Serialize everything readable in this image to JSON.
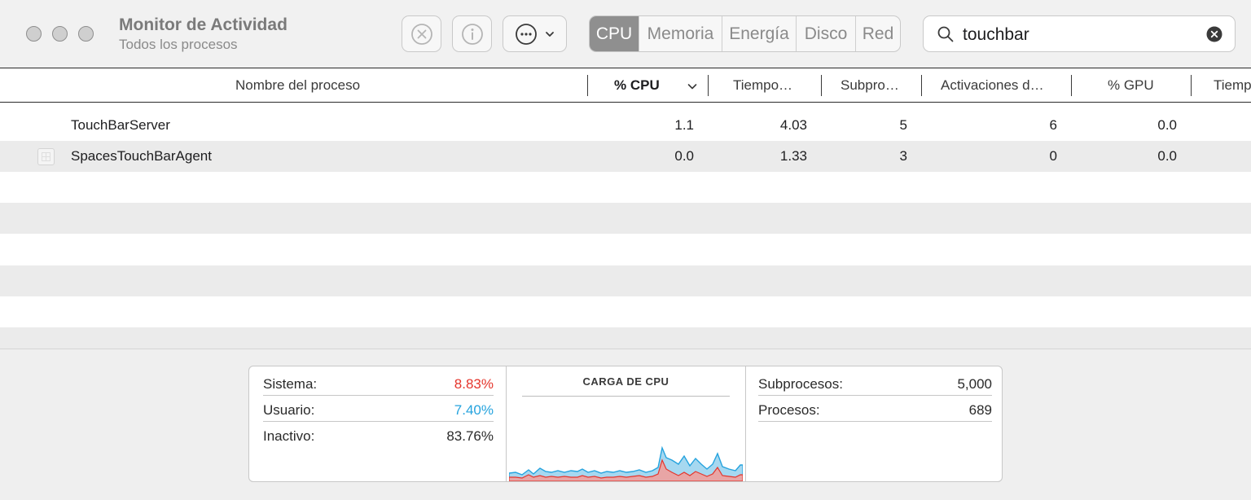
{
  "window": {
    "title": "Monitor de Actividad",
    "subtitle": "Todos los procesos"
  },
  "toolbar": {
    "stop_icon": "stop-process-icon",
    "info_icon": "info-icon",
    "more_icon": "ellipsis-icon",
    "tabs": [
      {
        "label": "CPU",
        "active": true
      },
      {
        "label": "Memoria",
        "active": false
      },
      {
        "label": "Energía",
        "active": false
      },
      {
        "label": "Disco",
        "active": false
      },
      {
        "label": "Red",
        "active": false
      }
    ]
  },
  "search": {
    "value": "touchbar"
  },
  "table": {
    "columns": [
      "Nombre del proceso",
      "% CPU",
      "Tiempo…",
      "Subpro…",
      "Activaciones d…",
      "% GPU",
      "Tiemp"
    ],
    "sorted_column": "% CPU",
    "rows": [
      {
        "name": "TouchBarServer",
        "cpu": "1.1",
        "time": "4.03",
        "threads": "5",
        "wakes": "6",
        "gpu": "0.0"
      },
      {
        "name": "SpacesTouchBarAgent",
        "cpu": "0.0",
        "time": "1.33",
        "threads": "3",
        "wakes": "0",
        "gpu": "0.0"
      }
    ]
  },
  "stats": {
    "left": [
      {
        "label": "Sistema:",
        "value": "8.83%",
        "color": "#e5352c"
      },
      {
        "label": "Usuario:",
        "value": "7.40%",
        "color": "#25a3de"
      },
      {
        "label": "Inactivo:",
        "value": "83.76%",
        "color": "#2a2a2a"
      }
    ],
    "graph_title": "CARGA DE CPU",
    "right": [
      {
        "label": "Subprocesos:",
        "value": "5,000"
      },
      {
        "label": "Procesos:",
        "value": "689"
      }
    ]
  },
  "colors": {
    "system": "#e5352c",
    "user": "#25a3de",
    "active_tab": "#8f8f8f"
  }
}
